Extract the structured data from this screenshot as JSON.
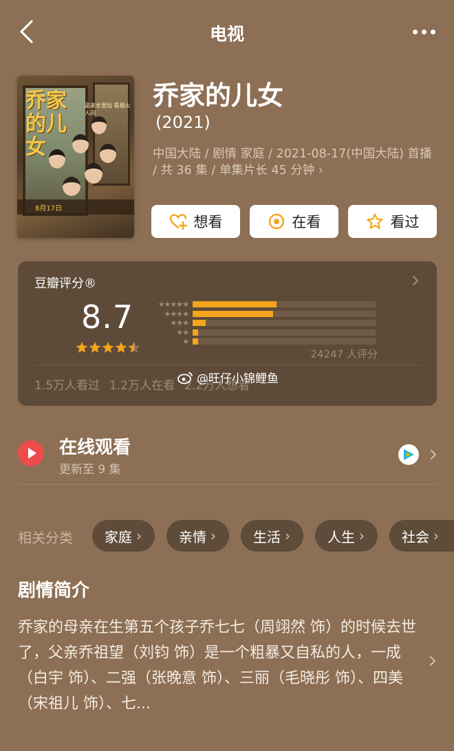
{
  "nav": {
    "title": "电视"
  },
  "poster": {
    "title_art": "乔家的儿女",
    "tagline": "品家长里短  看烟火人间",
    "date_strip": "8月17日"
  },
  "show": {
    "title": "乔家的儿女",
    "year": "(2021)",
    "meta": "中国大陆 / 剧情 家庭 / 2021-08-17(中国大陆) 首播 / 共 36 集 / 单集片长 45 分钟 ›"
  },
  "actions": [
    {
      "label": "想看",
      "icon": "heart-plus-icon"
    },
    {
      "label": "在看",
      "icon": "target-icon"
    },
    {
      "label": "看过",
      "icon": "star-outline-icon"
    }
  ],
  "rating": {
    "label": "豆瓣评分®",
    "score": "8.7",
    "star_value": 4.5,
    "distribution": [
      0.46,
      0.44,
      0.07,
      0.02,
      0.03
    ],
    "raters": "24247 人评分",
    "watched": "1.5万人看过",
    "watching": "1.2万人在看",
    "want": "2.2万人想看"
  },
  "watermark": "@旺仔小锦鲤鱼",
  "watch_online": {
    "title": "在线观看",
    "subtitle": "更新至 9 集"
  },
  "categories": {
    "label": "相关分类",
    "items": [
      "家庭",
      "亲情",
      "生活",
      "人生",
      "社会"
    ]
  },
  "synopsis": {
    "title": "剧情简介",
    "text": "乔家的母亲在生第五个孩子乔七七（周翊然 饰）的时候去世了，父亲乔祖望（刘钧 饰）是一个粗暴又自私的人，一成（白宇 饰）、二强（张晚意 饰）、三丽（毛晓彤 饰）、四美（宋祖儿 饰）、七..."
  },
  "colors": {
    "background": "#8c6f54",
    "card": "#5e4a38",
    "accent_orange": "#f4a51c",
    "play_red": "#ee4b4b"
  }
}
